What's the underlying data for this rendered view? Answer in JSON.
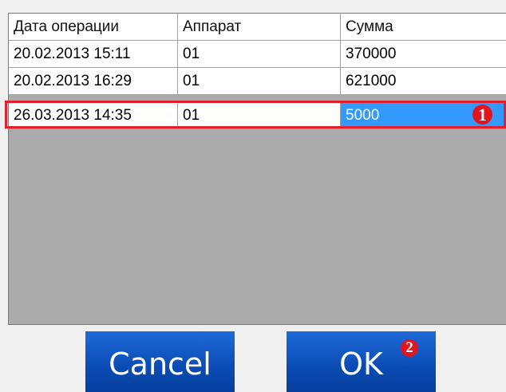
{
  "table": {
    "columns": [
      "Дата операции",
      "Аппарат",
      "Сумма"
    ],
    "rows": [
      {
        "date": "20.02.2013 15:11",
        "device": "01",
        "amount": "370000"
      },
      {
        "date": "20.02.2013 16:29",
        "device": "01",
        "amount": "621000"
      },
      {
        "date": "26.03.2013 14:35",
        "device": "01",
        "amount": "5000"
      }
    ]
  },
  "annotations": {
    "badge_1": "1",
    "badge_2": "2",
    "highlight_color": "#e0202c"
  },
  "buttons": {
    "cancel_label": "Cancel",
    "ok_label": "OK"
  },
  "colors": {
    "selection": "#3399ff",
    "button_blue": "#0a4bb3",
    "grid_background": "#ababab"
  }
}
